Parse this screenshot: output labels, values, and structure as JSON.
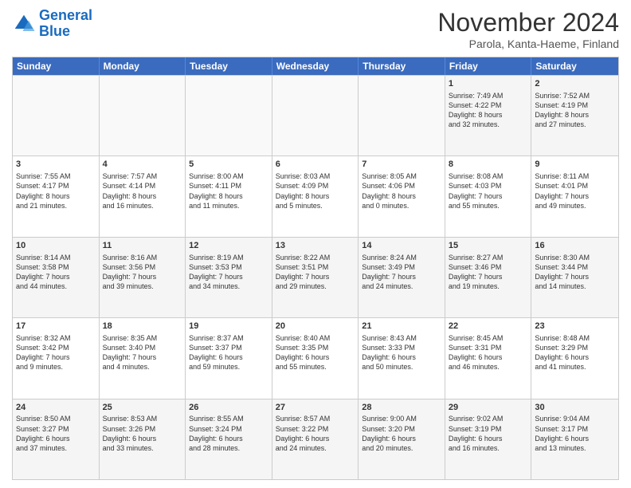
{
  "header": {
    "logo_line1": "General",
    "logo_line2": "Blue",
    "month": "November 2024",
    "location": "Parola, Kanta-Haeme, Finland"
  },
  "days": [
    "Sunday",
    "Monday",
    "Tuesday",
    "Wednesday",
    "Thursday",
    "Friday",
    "Saturday"
  ],
  "weeks": [
    [
      {
        "day": "",
        "info": "",
        "empty": true
      },
      {
        "day": "",
        "info": "",
        "empty": true
      },
      {
        "day": "",
        "info": "",
        "empty": true
      },
      {
        "day": "",
        "info": "",
        "empty": true
      },
      {
        "day": "",
        "info": "",
        "empty": true
      },
      {
        "day": "1",
        "info": "Sunrise: 7:49 AM\nSunset: 4:22 PM\nDaylight: 8 hours\nand 32 minutes."
      },
      {
        "day": "2",
        "info": "Sunrise: 7:52 AM\nSunset: 4:19 PM\nDaylight: 8 hours\nand 27 minutes."
      }
    ],
    [
      {
        "day": "3",
        "info": "Sunrise: 7:55 AM\nSunset: 4:17 PM\nDaylight: 8 hours\nand 21 minutes."
      },
      {
        "day": "4",
        "info": "Sunrise: 7:57 AM\nSunset: 4:14 PM\nDaylight: 8 hours\nand 16 minutes."
      },
      {
        "day": "5",
        "info": "Sunrise: 8:00 AM\nSunset: 4:11 PM\nDaylight: 8 hours\nand 11 minutes."
      },
      {
        "day": "6",
        "info": "Sunrise: 8:03 AM\nSunset: 4:09 PM\nDaylight: 8 hours\nand 5 minutes."
      },
      {
        "day": "7",
        "info": "Sunrise: 8:05 AM\nSunset: 4:06 PM\nDaylight: 8 hours\nand 0 minutes."
      },
      {
        "day": "8",
        "info": "Sunrise: 8:08 AM\nSunset: 4:03 PM\nDaylight: 7 hours\nand 55 minutes."
      },
      {
        "day": "9",
        "info": "Sunrise: 8:11 AM\nSunset: 4:01 PM\nDaylight: 7 hours\nand 49 minutes."
      }
    ],
    [
      {
        "day": "10",
        "info": "Sunrise: 8:14 AM\nSunset: 3:58 PM\nDaylight: 7 hours\nand 44 minutes."
      },
      {
        "day": "11",
        "info": "Sunrise: 8:16 AM\nSunset: 3:56 PM\nDaylight: 7 hours\nand 39 minutes."
      },
      {
        "day": "12",
        "info": "Sunrise: 8:19 AM\nSunset: 3:53 PM\nDaylight: 7 hours\nand 34 minutes."
      },
      {
        "day": "13",
        "info": "Sunrise: 8:22 AM\nSunset: 3:51 PM\nDaylight: 7 hours\nand 29 minutes."
      },
      {
        "day": "14",
        "info": "Sunrise: 8:24 AM\nSunset: 3:49 PM\nDaylight: 7 hours\nand 24 minutes."
      },
      {
        "day": "15",
        "info": "Sunrise: 8:27 AM\nSunset: 3:46 PM\nDaylight: 7 hours\nand 19 minutes."
      },
      {
        "day": "16",
        "info": "Sunrise: 8:30 AM\nSunset: 3:44 PM\nDaylight: 7 hours\nand 14 minutes."
      }
    ],
    [
      {
        "day": "17",
        "info": "Sunrise: 8:32 AM\nSunset: 3:42 PM\nDaylight: 7 hours\nand 9 minutes."
      },
      {
        "day": "18",
        "info": "Sunrise: 8:35 AM\nSunset: 3:40 PM\nDaylight: 7 hours\nand 4 minutes."
      },
      {
        "day": "19",
        "info": "Sunrise: 8:37 AM\nSunset: 3:37 PM\nDaylight: 6 hours\nand 59 minutes."
      },
      {
        "day": "20",
        "info": "Sunrise: 8:40 AM\nSunset: 3:35 PM\nDaylight: 6 hours\nand 55 minutes."
      },
      {
        "day": "21",
        "info": "Sunrise: 8:43 AM\nSunset: 3:33 PM\nDaylight: 6 hours\nand 50 minutes."
      },
      {
        "day": "22",
        "info": "Sunrise: 8:45 AM\nSunset: 3:31 PM\nDaylight: 6 hours\nand 46 minutes."
      },
      {
        "day": "23",
        "info": "Sunrise: 8:48 AM\nSunset: 3:29 PM\nDaylight: 6 hours\nand 41 minutes."
      }
    ],
    [
      {
        "day": "24",
        "info": "Sunrise: 8:50 AM\nSunset: 3:27 PM\nDaylight: 6 hours\nand 37 minutes."
      },
      {
        "day": "25",
        "info": "Sunrise: 8:53 AM\nSunset: 3:26 PM\nDaylight: 6 hours\nand 33 minutes."
      },
      {
        "day": "26",
        "info": "Sunrise: 8:55 AM\nSunset: 3:24 PM\nDaylight: 6 hours\nand 28 minutes."
      },
      {
        "day": "27",
        "info": "Sunrise: 8:57 AM\nSunset: 3:22 PM\nDaylight: 6 hours\nand 24 minutes."
      },
      {
        "day": "28",
        "info": "Sunrise: 9:00 AM\nSunset: 3:20 PM\nDaylight: 6 hours\nand 20 minutes."
      },
      {
        "day": "29",
        "info": "Sunrise: 9:02 AM\nSunset: 3:19 PM\nDaylight: 6 hours\nand 16 minutes."
      },
      {
        "day": "30",
        "info": "Sunrise: 9:04 AM\nSunset: 3:17 PM\nDaylight: 6 hours\nand 13 minutes."
      }
    ]
  ]
}
